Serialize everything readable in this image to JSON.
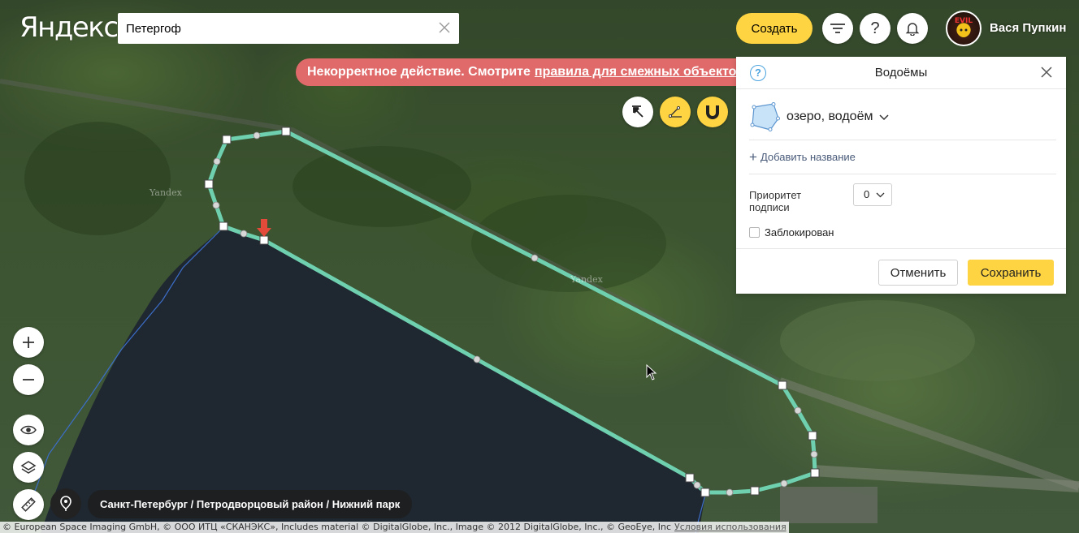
{
  "header": {
    "logo_text": "Яндекс",
    "search": {
      "value": "Петергоф"
    },
    "create_label": "Создать",
    "user_name": "Вася Пупкин"
  },
  "error": {
    "message": "Некорректное действие. Смотрите",
    "link_text": "правила для смежных объектов"
  },
  "map": {
    "watermark": "Yandex",
    "breadcrumb": "Санкт-Петербург / Петродворцовый район / Нижний парк",
    "copyright": "© European Space Imaging GmbH, © ООО ИТЦ «СКАНЭКС», Includes material © DigitalGlobe, Inc., Image © 2012 DigitalGlobe, Inc., © GeoEye, Inc",
    "terms_link": "Условия использования"
  },
  "panel": {
    "title": "Водоёмы",
    "object_type": "озеро, водоём",
    "add_name_label": "Добавить название",
    "priority_label": "Приоритет подписи",
    "priority_value": "0",
    "locked_label": "Заблокирован",
    "locked": false,
    "cancel_label": "Отменить",
    "save_label": "Сохранить"
  },
  "colors": {
    "accent_yellow": "#ffd442",
    "error_red": "#e06a6a",
    "polygon_stroke": "#6fd0b0"
  },
  "icons": {
    "search_clear": "close-icon",
    "filter": "filter-icon",
    "help": "question-icon",
    "notifications": "bell-icon",
    "select_tool": "cursor-arrow-icon",
    "draw_tool": "draw-line-icon",
    "snap_tool": "magnet-icon",
    "zoom_in": "plus-icon",
    "zoom_out": "minus-icon",
    "view": "eye-icon",
    "layers": "layers-icon",
    "ruler": "ruler-icon",
    "locate": "location-pin-icon"
  }
}
